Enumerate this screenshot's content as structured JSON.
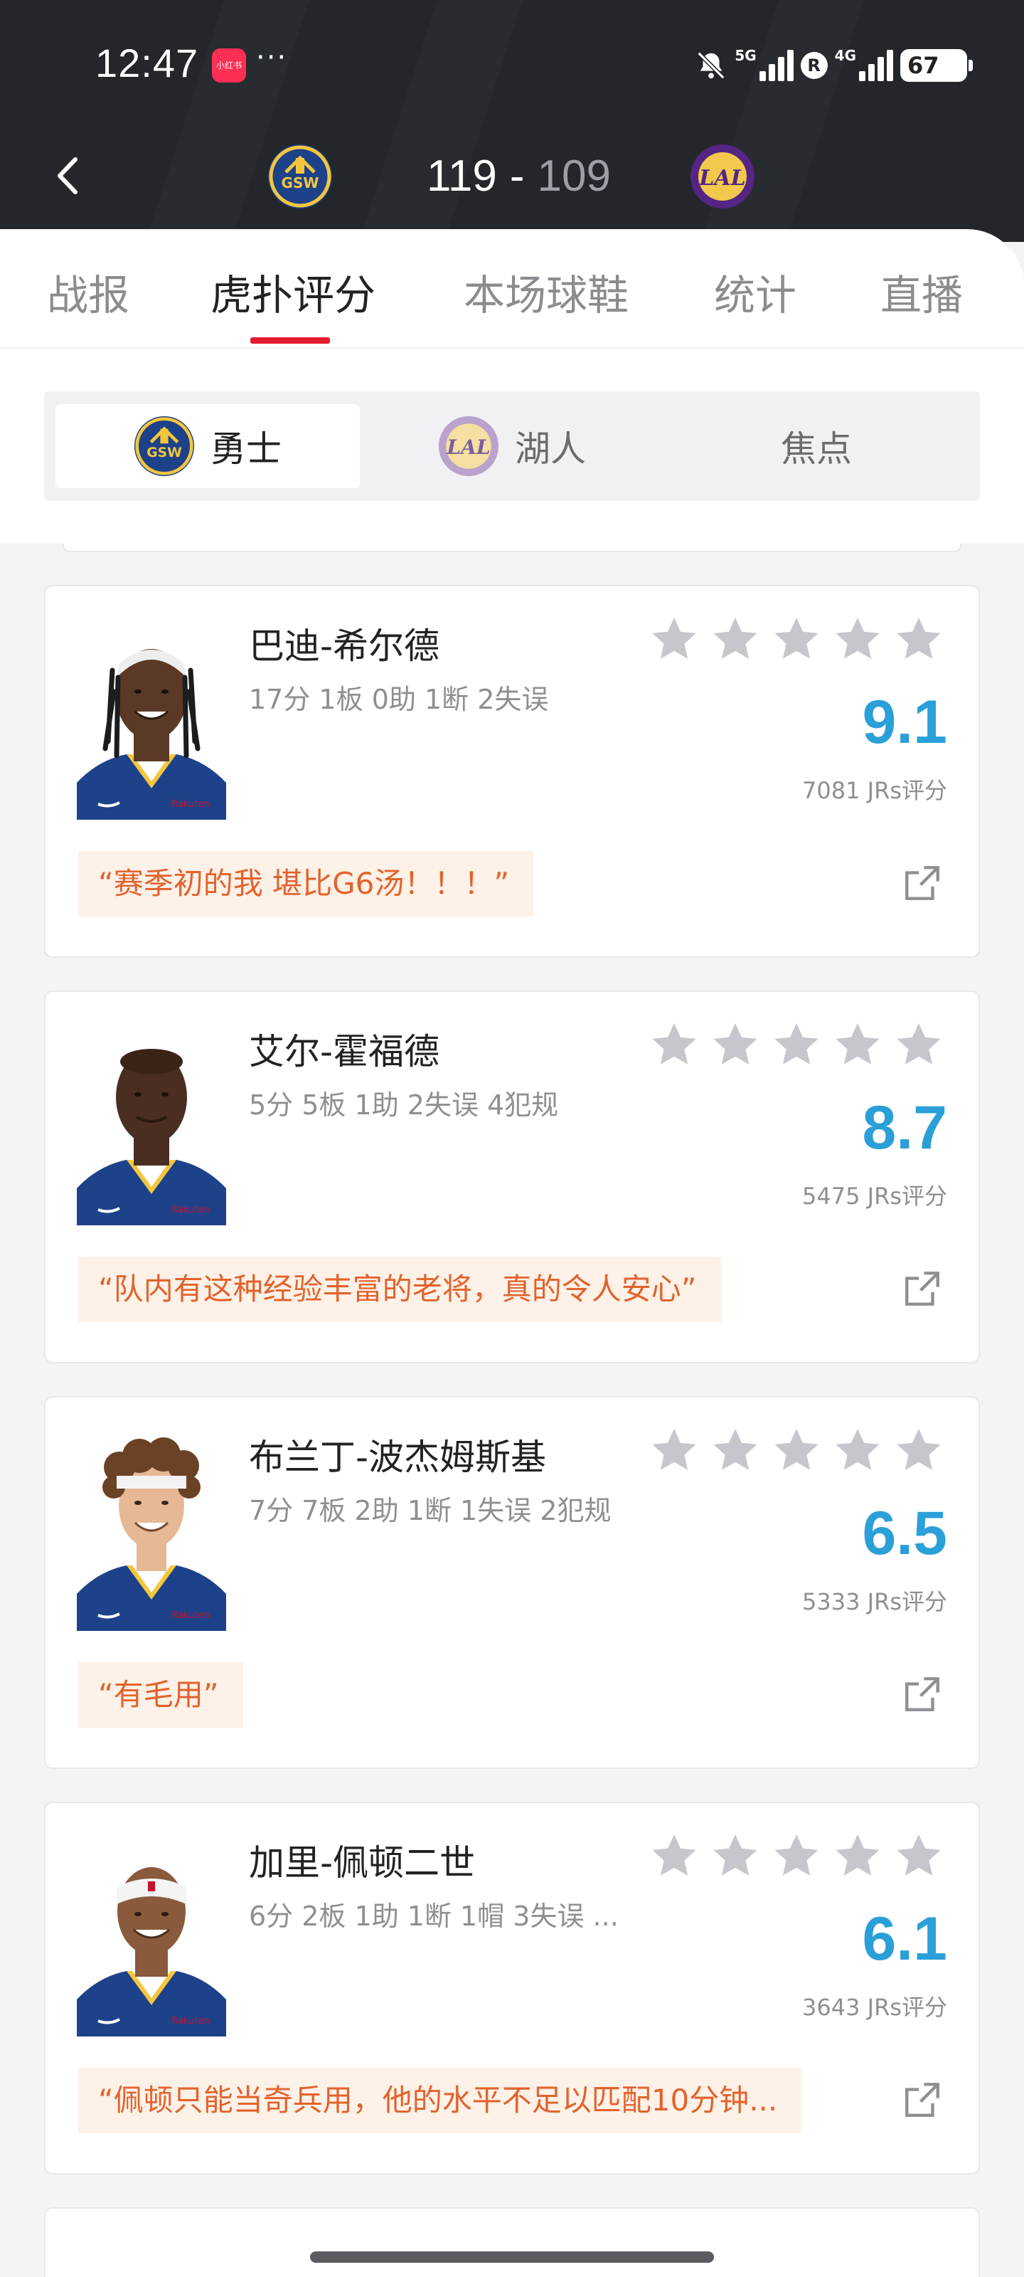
{
  "status_bar": {
    "time": "12:47",
    "app_badge": "小红书",
    "more": "···",
    "sig1_label": "5G",
    "sig2_label": "4G",
    "r_badge": "R",
    "battery": "67"
  },
  "header": {
    "home_team_abbr": "GSW",
    "away_team_abbr": "LAL",
    "home_score": "119",
    "separator": "-",
    "away_score": "109",
    "home_color": "#f4c63d",
    "away_color": "#f2c94c",
    "back_icon": "chevron-left-icon"
  },
  "tabs": [
    "战报",
    "虎扑评分",
    "本场球鞋",
    "统计",
    "直播"
  ],
  "active_tab": "虎扑评分",
  "segments": [
    "勇士",
    "湖人",
    "焦点"
  ],
  "active_segment": "勇士",
  "players": [
    {
      "name": "巴迪-希尔德",
      "stats": "17分 1板 0助 1断 2失误",
      "rating": "9.1",
      "votes": "7081 JRs评分",
      "quote": "“赛季初的我 堪比G6汤！！！”"
    },
    {
      "name": "艾尔-霍福德",
      "stats": "5分 5板 1助 2失误 4犯规",
      "rating": "8.7",
      "votes": "5475 JRs评分",
      "quote": "“队内有这种经验丰富的老将，真的令人安心”"
    },
    {
      "name": "布兰丁-波杰姆斯基",
      "stats": "7分 7板 2助 1断 1失误 2犯规",
      "rating": "6.5",
      "votes": "5333 JRs评分",
      "quote": "“有毛用”"
    },
    {
      "name": "加里-佩顿二世",
      "stats": "6分 2板 1助 1断 1帽 3失误 ...",
      "rating": "6.1",
      "votes": "3643 JRs评分",
      "quote": "“佩顿只能当奇兵用，他的水平不足以匹配10分钟..."
    }
  ],
  "colors": {
    "header_bg": "#23262b",
    "accent_red": "#e21b2f",
    "rating_blue": "#2a9fd8",
    "quote_orange": "#e2632c",
    "quote_bg": "#fdf1e8",
    "gsw_blue": "#1d428a",
    "lal_purple": "#552583"
  }
}
